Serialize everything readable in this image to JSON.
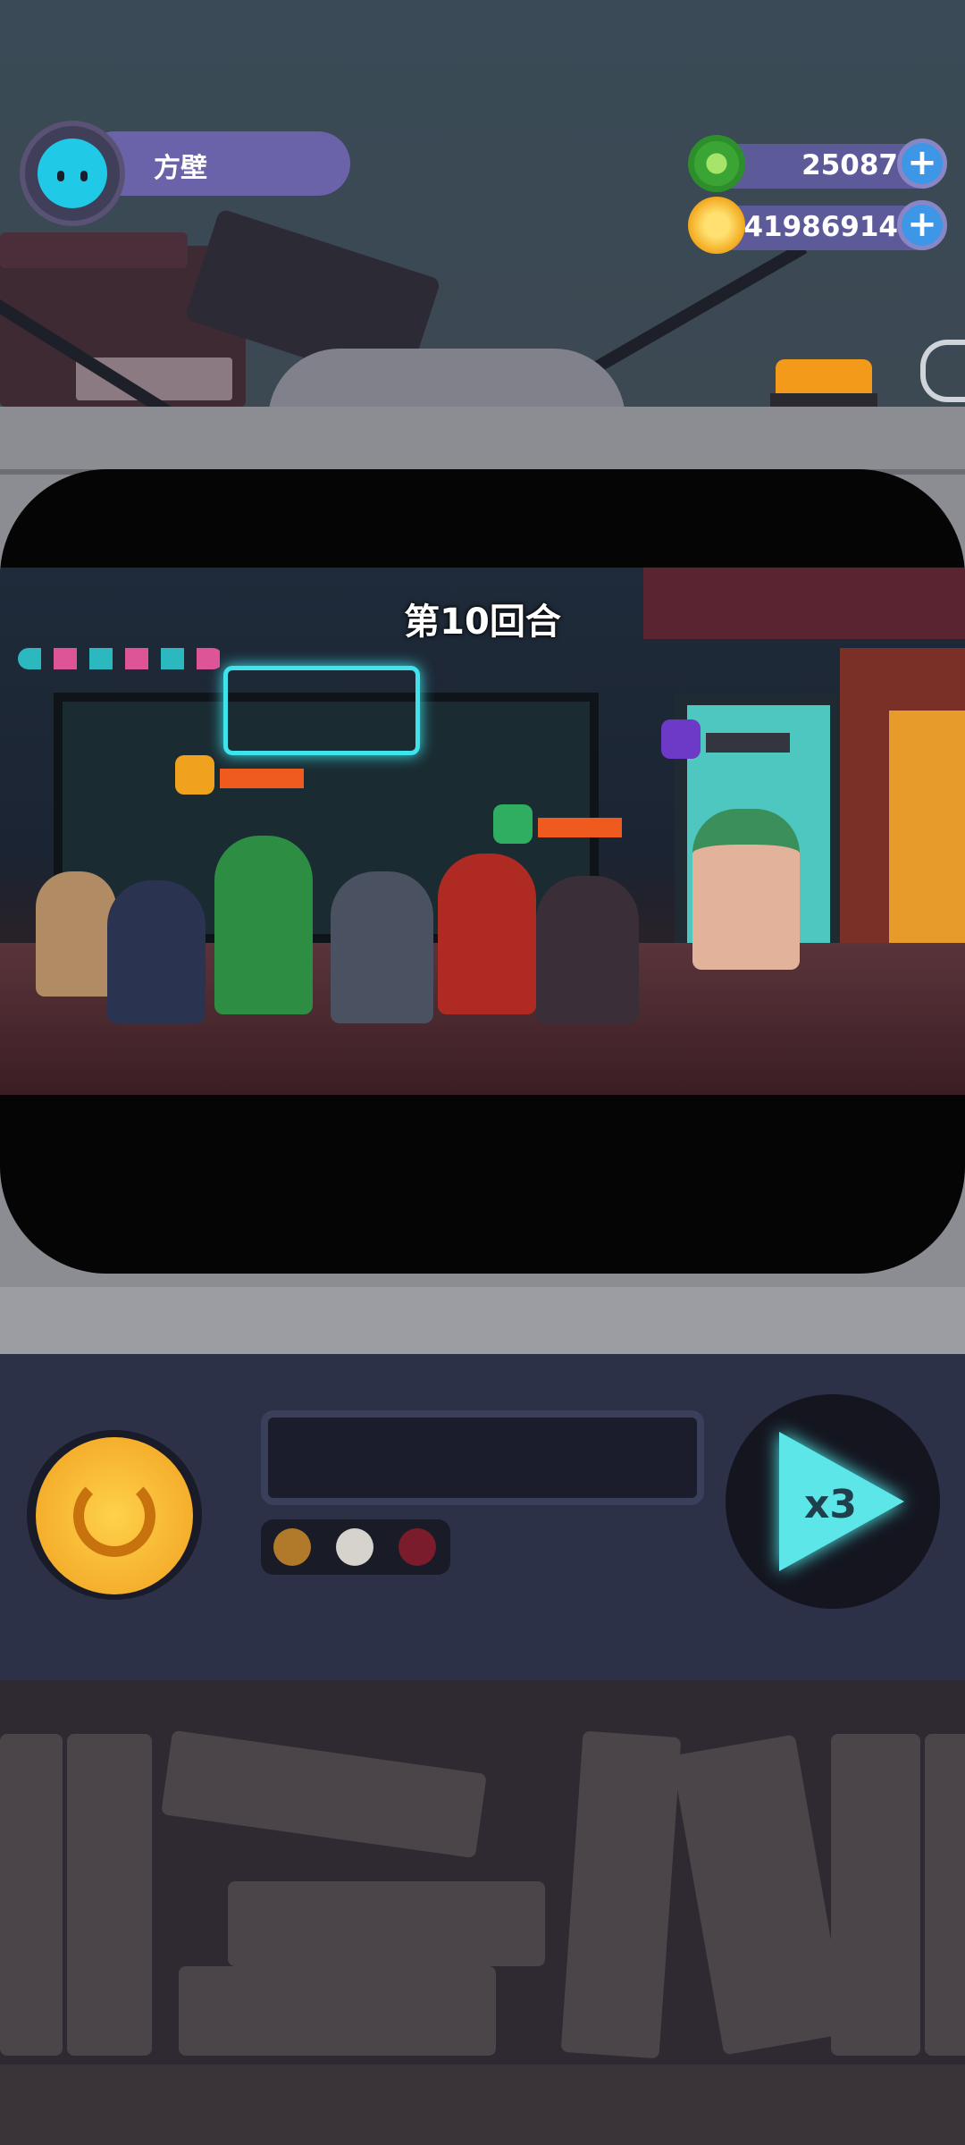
{
  "profile": {
    "name": "方壁",
    "avatar_icon": "cat-face-icon"
  },
  "currencies": [
    {
      "icon": "green-gem-coin-icon",
      "value": "25087",
      "color": "#4cc63a"
    },
    {
      "icon": "gold-planet-coin-icon",
      "value": "41986914",
      "color": "#f4b81f"
    }
  ],
  "battle": {
    "round_label": "第10回合"
  },
  "controls": {
    "replay_icon": "replay-icon",
    "speed_label": "x3",
    "indicator_colors": [
      "#b07a2a",
      "#d6d3cc",
      "#7a1c2c"
    ]
  },
  "colors": {
    "accent_purple": "#6b63a9",
    "plus_blue": "#3d96e6",
    "health_orange": "#ef5a1f",
    "speed_cyan": "#5de6e8"
  }
}
